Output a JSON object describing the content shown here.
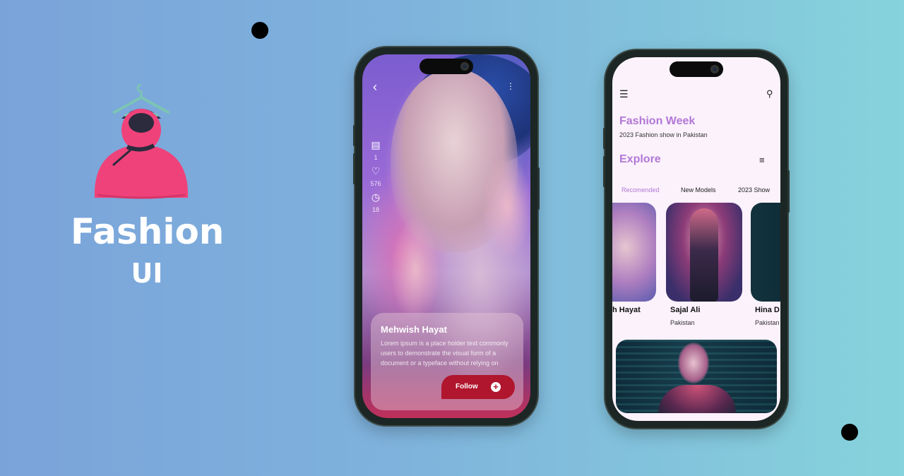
{
  "brand": {
    "title": "Fashion",
    "subtitle": "UI"
  },
  "colors": {
    "accent": "#b278d6",
    "follow": "#b0162d",
    "logo_pink": "#f0427a",
    "logo_teal": "#7cc4b4"
  },
  "detail_screen": {
    "icons": [
      "back-icon",
      "more-icon",
      "comment-icon",
      "heart-icon",
      "clock-icon",
      "plus-icon"
    ],
    "stats": {
      "comments": "1",
      "likes": "576",
      "time": "18"
    },
    "card": {
      "name": "Mehwish Hayat",
      "description": "Lorem ipsum is a place holder text commonly users to demonstrate the visual form of a document or a typeface without relying on",
      "follow_label": "Follow"
    }
  },
  "home_screen": {
    "icons": [
      "menu-icon",
      "search-icon",
      "filter-icon"
    ],
    "title": "Fashion Week",
    "subtitle": "2023 Fashion show in Pakistan",
    "section": "Explore",
    "tabs": [
      {
        "label": "Recomended",
        "active": true
      },
      {
        "label": "New Models",
        "active": false
      },
      {
        "label": "2023 Show",
        "active": false
      }
    ],
    "models": [
      {
        "name": "h Hayat",
        "country": ""
      },
      {
        "name": "Sajal Ali",
        "country": "Pakistan"
      },
      {
        "name": "Hina D",
        "country": "Pakistan"
      }
    ]
  }
}
